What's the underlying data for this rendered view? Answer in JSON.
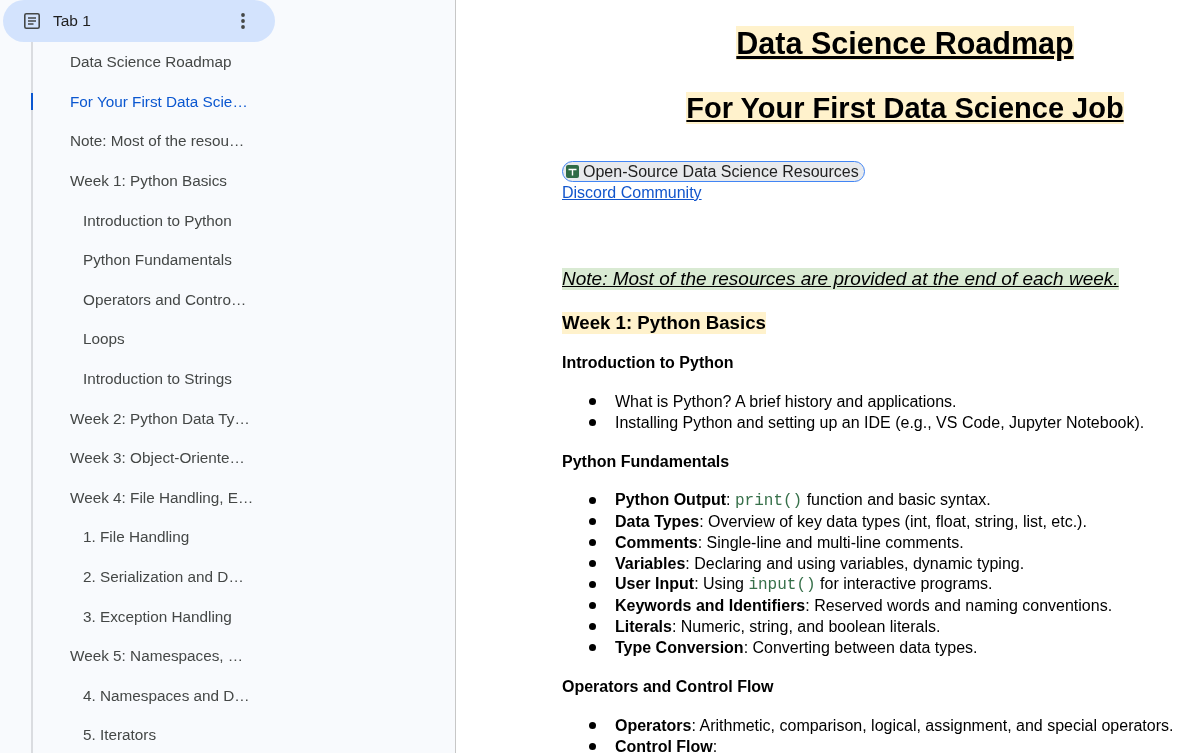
{
  "sidebar": {
    "tab": {
      "label": "Tab 1",
      "selected": true
    },
    "outline": [
      {
        "label": "Data Science Roadmap",
        "selected": false
      },
      {
        "label": "For Your First Data Scie…",
        "selected": true
      },
      {
        "label": "Note: Most of the resou…",
        "selected": false
      },
      {
        "label": "Week 1: Python Basics",
        "selected": false,
        "children": [
          {
            "label": "Introduction to Python",
            "selected": false
          },
          {
            "label": "Python Fundamentals",
            "selected": false
          },
          {
            "label": "Operators and Contro…",
            "selected": false
          },
          {
            "label": "Loops",
            "selected": false
          },
          {
            "label": "Introduction to Strings",
            "selected": false
          }
        ]
      },
      {
        "label": "Week 2: Python Data Ty…",
        "selected": false
      },
      {
        "label": "Week 3: Object-Oriente…",
        "selected": false
      },
      {
        "label": "Week 4: File Handling, E…",
        "selected": false,
        "children": [
          {
            "label": "1. File Handling",
            "selected": false
          },
          {
            "label": "2. Serialization and D…",
            "selected": false
          },
          {
            "label": "3. Exception Handling",
            "selected": false
          }
        ]
      },
      {
        "label": "Week 5: Namespaces, …",
        "selected": false,
        "children": [
          {
            "label": "4. Namespaces and D…",
            "selected": false
          },
          {
            "label": "5. Iterators",
            "selected": false
          }
        ]
      }
    ]
  },
  "document": {
    "title": "Data Science Roadmap",
    "subtitle": "For Your First Data Science Job",
    "resource_chip": "Open-Source Data Science Resources",
    "link": "Discord Community",
    "note": "Note: Most of the resources are provided at the end of each week.",
    "weeks": [
      {
        "heading": "Week 1: Python Basics",
        "sections": [
          {
            "heading": "Introduction to Python",
            "items": [
              {
                "parts": [
                  {
                    "kind": "plain",
                    "text": "What is Python? A brief history and applications."
                  }
                ]
              },
              {
                "parts": [
                  {
                    "kind": "plain",
                    "text": "Installing Python and setting up an IDE (e.g., VS Code, Jupyter Notebook)."
                  }
                ]
              }
            ]
          },
          {
            "heading": "Python Fundamentals",
            "items": [
              {
                "parts": [
                  {
                    "kind": "bold",
                    "text": "Python Output"
                  },
                  {
                    "kind": "plain",
                    "text": ": "
                  },
                  {
                    "kind": "code",
                    "text": "print()"
                  },
                  {
                    "kind": "plain",
                    "text": " function and basic syntax."
                  }
                ]
              },
              {
                "parts": [
                  {
                    "kind": "bold",
                    "text": "Data Types"
                  },
                  {
                    "kind": "plain",
                    "text": ": Overview of key data types (int, float, string, list, etc.)."
                  }
                ]
              },
              {
                "parts": [
                  {
                    "kind": "bold",
                    "text": "Comments"
                  },
                  {
                    "kind": "plain",
                    "text": ": Single-line and multi-line comments."
                  }
                ]
              },
              {
                "parts": [
                  {
                    "kind": "bold",
                    "text": "Variables"
                  },
                  {
                    "kind": "plain",
                    "text": ": Declaring and using variables, dynamic typing."
                  }
                ]
              },
              {
                "parts": [
                  {
                    "kind": "bold",
                    "text": "User Input"
                  },
                  {
                    "kind": "plain",
                    "text": ": Using "
                  },
                  {
                    "kind": "code",
                    "text": "input()"
                  },
                  {
                    "kind": "plain",
                    "text": " for interactive programs."
                  }
                ]
              },
              {
                "parts": [
                  {
                    "kind": "bold",
                    "text": "Keywords and Identifiers"
                  },
                  {
                    "kind": "plain",
                    "text": ": Reserved words and naming conventions."
                  }
                ]
              },
              {
                "parts": [
                  {
                    "kind": "bold",
                    "text": "Literals"
                  },
                  {
                    "kind": "plain",
                    "text": ": Numeric, string, and boolean literals."
                  }
                ]
              },
              {
                "parts": [
                  {
                    "kind": "bold",
                    "text": "Type Conversion"
                  },
                  {
                    "kind": "plain",
                    "text": ": Converting between data types."
                  }
                ]
              }
            ]
          },
          {
            "heading": "Operators and Control Flow",
            "items": [
              {
                "parts": [
                  {
                    "kind": "bold",
                    "text": "Operators"
                  },
                  {
                    "kind": "plain",
                    "text": ": Arithmetic, comparison, logical, assignment, and special operators."
                  }
                ]
              },
              {
                "parts": [
                  {
                    "kind": "bold",
                    "text": "Control Flow"
                  },
                  {
                    "kind": "plain",
                    "text": ":"
                  }
                ]
              }
            ]
          }
        ]
      }
    ]
  }
}
